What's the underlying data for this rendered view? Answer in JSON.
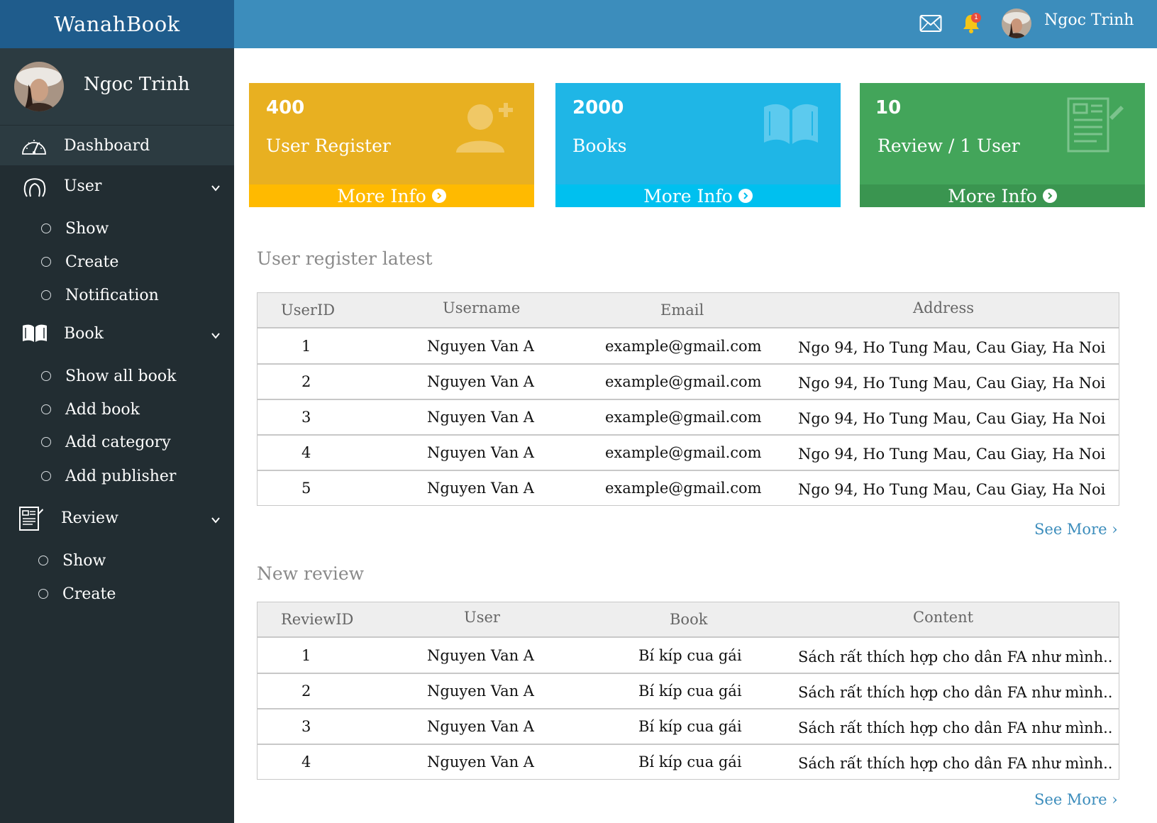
{
  "app": {
    "brand": "WanahBook"
  },
  "header": {
    "user_name": "Ngoc Trinh",
    "notification_count": "1",
    "icons": [
      "mail-icon",
      "bell-icon"
    ]
  },
  "sidebar": {
    "profile_name": "Ngoc Trinh",
    "menu": {
      "dashboard": "Dashboard",
      "user": "User",
      "user_items": [
        "Show",
        "Create",
        "Notification"
      ],
      "book": "Book",
      "book_items": [
        "Show all book",
        "Add book",
        "Add category",
        "Add publisher"
      ],
      "review": "Review",
      "review_items": [
        "Show",
        "Create"
      ]
    }
  },
  "cards": [
    {
      "value": "400",
      "label": "User Register",
      "footer": "More Info",
      "color": "#e8b021",
      "footer_color": "#ffba00",
      "icon": "user-add-icon"
    },
    {
      "value": "2000",
      "label": "Books",
      "footer": "More Info",
      "color": "#1fb6e6",
      "footer_color": "#00c0ef",
      "icon": "open-book-icon"
    },
    {
      "value": "10",
      "label": "Review / 1 User",
      "footer": "More Info",
      "color": "#43a55a",
      "footer_color": "#3a9550",
      "icon": "document-icon"
    }
  ],
  "users_section": {
    "title": "User register latest",
    "columns": [
      "UserID",
      "Username",
      "Email",
      "Address"
    ],
    "rows": [
      [
        "1",
        "Nguyen Van A",
        "example@gmail.com",
        "Ngo 94, Ho Tung Mau, Cau Giay, Ha Noi"
      ],
      [
        "2",
        "Nguyen Van A",
        "example@gmail.com",
        "Ngo 94, Ho Tung Mau, Cau Giay, Ha Noi"
      ],
      [
        "3",
        "Nguyen Van A",
        "example@gmail.com",
        "Ngo 94, Ho Tung Mau, Cau Giay, Ha Noi"
      ],
      [
        "4",
        "Nguyen Van A",
        "example@gmail.com",
        "Ngo 94, Ho Tung Mau, Cau Giay, Ha Noi"
      ],
      [
        "5",
        "Nguyen Van A",
        "example@gmail.com",
        "Ngo 94, Ho Tung Mau, Cau Giay, Ha Noi"
      ]
    ],
    "see_more": "See More ›"
  },
  "reviews_section": {
    "title": "New review",
    "columns": [
      "ReviewID",
      "User",
      "Book",
      "Content"
    ],
    "rows": [
      [
        "1",
        "Nguyen Van A",
        "Bí kíp cua gái",
        "Sách rất thích hợp cho dân FA như mình.."
      ],
      [
        "2",
        "Nguyen Van A",
        "Bí kíp cua gái",
        "Sách rất thích hợp cho dân FA như mình.."
      ],
      [
        "3",
        "Nguyen Van A",
        "Bí kíp cua gái",
        "Sách rất thích hợp cho dân FA như mình.."
      ],
      [
        "4",
        "Nguyen Van A",
        "Bí kíp cua gái",
        "Sách rất thích hợp cho dân FA như mình.."
      ]
    ],
    "see_more": "See More ›"
  }
}
